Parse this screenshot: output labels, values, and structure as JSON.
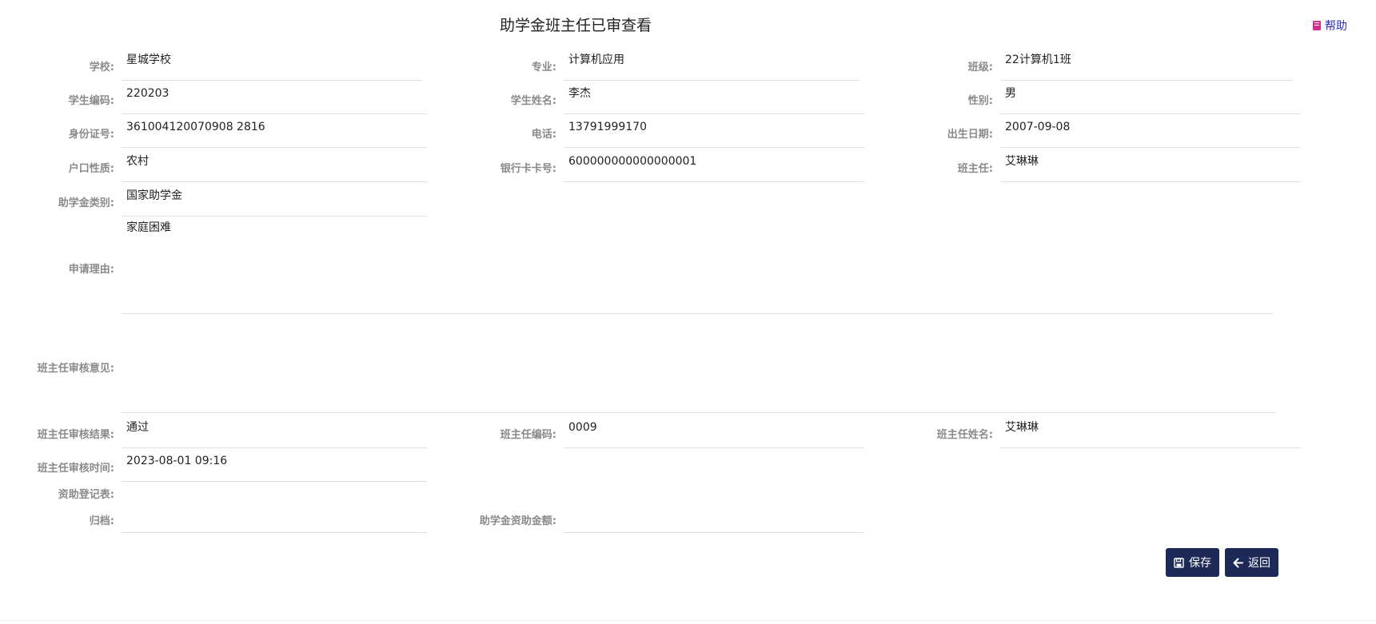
{
  "page": {
    "title": "助学金班主任已审查看",
    "help_label": "帮助"
  },
  "fields": {
    "school": {
      "label": "学校:",
      "value": "星城学校"
    },
    "major": {
      "label": "专业:",
      "value": "计算机应用"
    },
    "class": {
      "label": "班级:",
      "value": "22计算机1班"
    },
    "student_code": {
      "label": "学生编码:",
      "value": "220203"
    },
    "student_name": {
      "label": "学生姓名:",
      "value": "李杰"
    },
    "gender": {
      "label": "性别:",
      "value": "男"
    },
    "id_number": {
      "label": "身份证号:",
      "value": "361004120070908 2816"
    },
    "phone": {
      "label": "电话:",
      "value": "13791999170"
    },
    "birth_date": {
      "label": "出生日期:",
      "value": "2007-09-08"
    },
    "household_type": {
      "label": "户口性质:",
      "value": "农村"
    },
    "bank_card": {
      "label": "银行卡卡号:",
      "value": "600000000000000001"
    },
    "head_teacher": {
      "label": "班主任:",
      "value": "艾琳琳"
    },
    "grant_type": {
      "label": "助学金类别:",
      "value": "国家助学金"
    },
    "apply_reason": {
      "label": "申请理由:",
      "value": "家庭困难"
    },
    "teacher_opinion": {
      "label": "班主任审核意见:",
      "value": ""
    },
    "review_result": {
      "label": "班主任审核结果:",
      "value": "通过"
    },
    "teacher_code": {
      "label": "班主任编码:",
      "value": "0009"
    },
    "teacher_name": {
      "label": "班主任姓名:",
      "value": "艾琳琳"
    },
    "review_time": {
      "label": "班主任审核时间:",
      "value": "2023-08-01 09:16"
    },
    "register_form": {
      "label": "资助登记表:",
      "value": ""
    },
    "archive": {
      "label": "归档:",
      "value": ""
    },
    "grant_amount": {
      "label": "助学金资助金额:",
      "value": ""
    }
  },
  "actions": {
    "save_label": "保存",
    "back_label": "返回"
  },
  "colors": {
    "button_bg": "#1d2a57",
    "label": "#8a8a8a",
    "help_link": "#2b2bbf"
  }
}
